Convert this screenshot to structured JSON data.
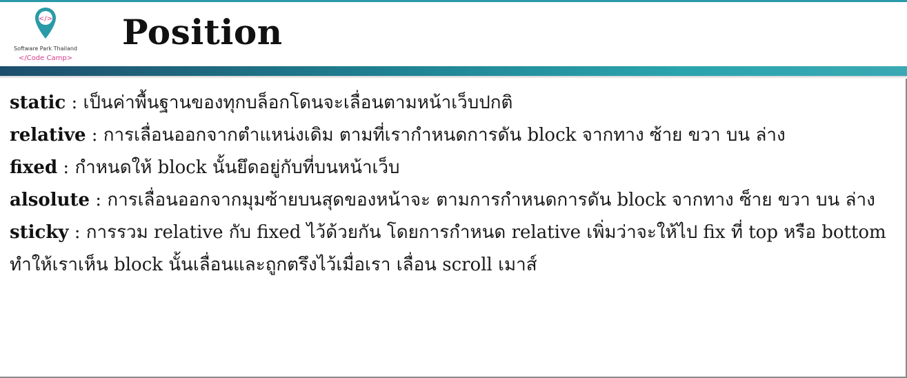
{
  "header": {
    "title": "Position",
    "logo": {
      "glyph": "</>",
      "name": "Software Park Thailand",
      "sub": "</Code Camp>"
    }
  },
  "colors": {
    "band": "#1f7e8f",
    "logo_pin": "#2a9aa8",
    "logo_accent": "#d63a8a"
  },
  "definitions": [
    {
      "term": "static",
      "sep": " : ",
      "desc": "เป็นค่าพื้นฐานของทุกบล็อกโดนจะเลื่อนตามหน้าเว็บปกติ"
    },
    {
      "term": "relative",
      "sep": " : ",
      "desc": "การเลื่อนออกจากตำแหน่งเดิม ตามที่เรากำหนดการดัน block จากทาง ซ้าย ขวา บน ล่าง"
    },
    {
      "term": "fixed",
      "sep": " : ",
      "desc": "กำหนดให้ block นั้นยึดอยู่กับที่บนหน้าเว็บ"
    },
    {
      "term": "alsolute",
      "sep": " : ",
      "desc": "การเลื่อนออกจากมุมซ้ายบนสุดของหน้าจะ ตามการกำหนดการดัน block จากทาง ซ็าย ขวา บน ล่าง"
    },
    {
      "term": "sticky",
      "sep": " : ",
      "desc": "การรวม relative กับ fixed ไว้ด้วยกัน โดยการกำหนด relative เพิ่มว่าจะให้ไป fix ที่ top หรือ bottom ทำให้เราเห็น block นั้นเลื่อนและถูกตรึงไว้เมื่อเรา เลื่อน scroll เมาส์"
    }
  ]
}
